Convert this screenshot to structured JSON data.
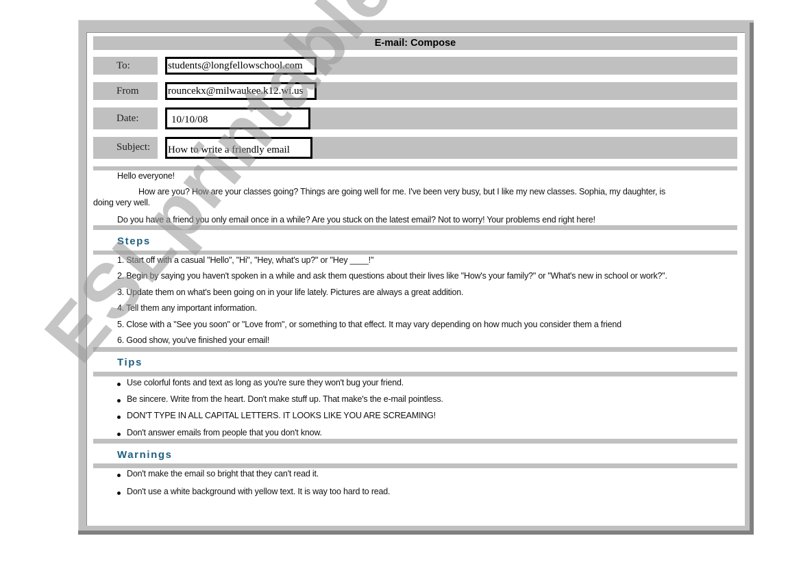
{
  "window": {
    "title": "E-mail: Compose"
  },
  "header_fields": [
    {
      "label": "To:",
      "value": "students@longfellowschool.com"
    },
    {
      "label": "From",
      "value": "rouncekx@milwaukee.k12.wi.us"
    },
    {
      "label": "Date:",
      "value": "10/10/08"
    },
    {
      "label": "Subject:",
      "value": "How to write a friendly email"
    }
  ],
  "body": {
    "greeting": "Hello everyone!",
    "intro_line1": "How are you?  How are your classes going? Things are going well for me.  I've been very busy, but I like my new classes.  Sophia, my daughter, is",
    "intro_line2": "doing very well.",
    "intro_para2": "Do you have a friend you only email once in a while? Are you stuck on the latest email? Not to worry! Your problems end right here!"
  },
  "sections": {
    "steps": {
      "heading": "Steps",
      "items": [
        "1.  Start off with a casual \"Hello\", \"Hi\", \"Hey, what's up?\" or \"Hey ____!\"",
        "2. Begin by saying you haven't spoken in a while and ask them questions about their lives like \"How's your family?\" or \"What's new in school or work?\".",
        "3. Update them on what's been going on in your life lately. Pictures are always a great addition.",
        "4. Tell them any important information.",
        "5. Close with a \"See you soon\" or \"Love from\", or something to that effect. It may vary depending on how much you consider them a friend",
        "6. Good show, you've finished your email!"
      ]
    },
    "tips": {
      "heading": "Tips",
      "items": [
        "Use colorful fonts and text as long as you're sure they won't bug your friend.",
        "Be sincere. Write from the heart. Don't make stuff up. That make's the e-mail pointless.",
        "DON'T TYPE IN ALL CAPITAL LETTERS.  IT LOOKS LIKE YOU ARE SCREAMING!",
        "Don't answer emails from people that you don't know."
      ]
    },
    "warnings": {
      "heading": "Warnings",
      "items": [
        "Don't make the email so bright that they can't read it.",
        "Don't use a white background with yellow text. It is way too hard to read."
      ]
    }
  },
  "watermark": "ESLprintables.com",
  "colors": {
    "bar_gray": "#c0c0c0",
    "heading_teal": "#1f6080",
    "frame_shadow": "#808080"
  }
}
